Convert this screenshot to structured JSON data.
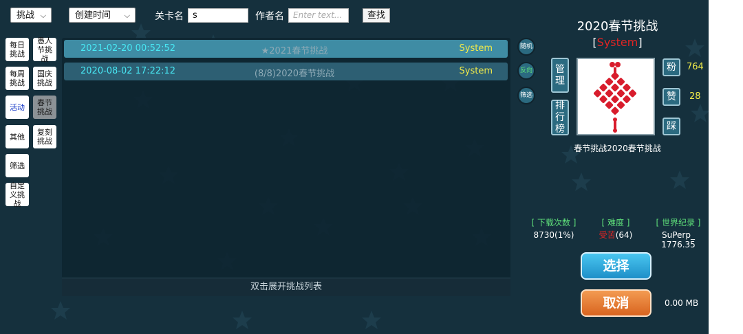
{
  "topbar": {
    "type_select": "挑战",
    "sort_select": "创建时间",
    "level_label": "关卡名",
    "level_value": "s",
    "author_label": "作者名",
    "author_placeholder": "Enter text...",
    "search_label": "查找"
  },
  "categories": {
    "daily": "每日挑战",
    "april_fools": "愚人节挑战",
    "weekly": "每周挑战",
    "national_day": "国庆挑战",
    "event": "活动",
    "spring": "春节挑战",
    "other": "其他",
    "reprint": "复刻挑战",
    "filter": "筛选",
    "custom": "自定义挑战"
  },
  "list": {
    "rows": [
      {
        "date": "2021-02-20 00:52:52",
        "title": "★2021春节挑战",
        "author": "System"
      },
      {
        "date": "2020-08-02 17:22:12",
        "title": "(8/8)2020春节挑战",
        "author": "System"
      }
    ],
    "footer": "双击展开挑战列表"
  },
  "side_buttons": {
    "random": "随机",
    "reverse": "反向",
    "filter": "筛选"
  },
  "detail": {
    "title": "2020春节挑战",
    "author_bracket_open": "[",
    "author": "System",
    "author_bracket_close": "]",
    "manage": "管理",
    "leaderboard": "排行榜",
    "fans_label": "粉",
    "fans_count": "764",
    "likes_label": "赞",
    "likes_count": "28",
    "dislike_label": "踩",
    "subtitle": "春节挑战2020春节挑战",
    "downloads_label": "[ 下载次数 ]",
    "downloads_value": "8730(1%)",
    "difficulty_label": "[ 难度 ]",
    "difficulty_word": "受苦",
    "difficulty_num": "(64)",
    "record_label": "[ 世界纪录 ]",
    "record_holder": "SuPerp_",
    "record_time": "1776.35",
    "select_button": "选择",
    "cancel_button": "取消",
    "file_size": "0.00 MB"
  },
  "colors": {
    "background": "#15303d",
    "selected_row": "#3f8ca4",
    "date_text": "#48e8f4",
    "author_text": "#f0ea4a",
    "highlight_red": "#e02424",
    "stat_header": "#5fe07a"
  }
}
